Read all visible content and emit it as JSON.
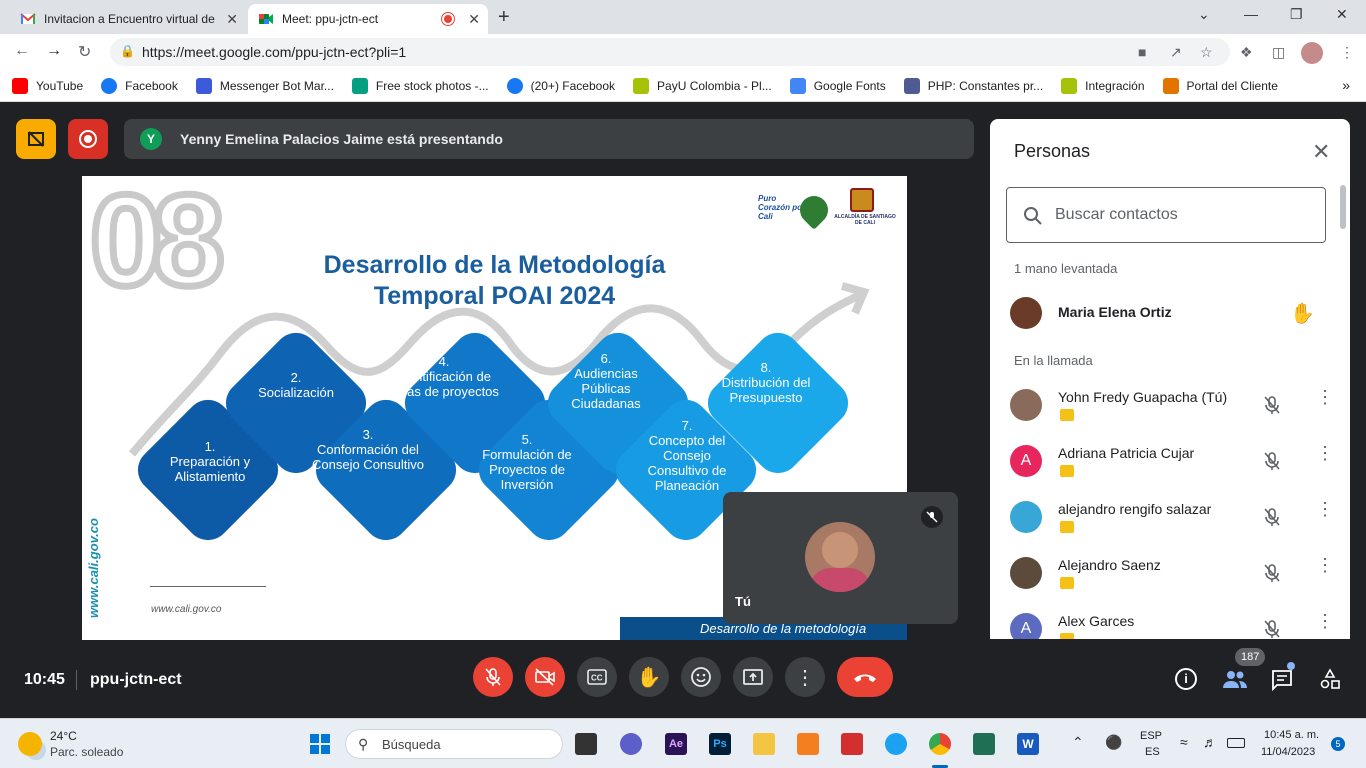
{
  "tabs": [
    {
      "title": "Invitacion a Encuentro virtual de",
      "icon": "gmail-icon",
      "close": "✕"
    },
    {
      "title": "Meet: ppu-jctn-ect",
      "icon": "meet-icon",
      "close": "✕"
    }
  ],
  "new_tab": "+",
  "window_controls": {
    "minimize": "—",
    "maximize": "❐",
    "close": "✕",
    "tab_search": "⌄"
  },
  "url": "https://meet.google.com/ppu-jctn-ect?pli=1",
  "bookmarks": [
    {
      "label": "YouTube",
      "color": "#ff0000"
    },
    {
      "label": "Facebook",
      "color": "#1877f2"
    },
    {
      "label": "Messenger Bot Mar...",
      "color": "#3b5bdb"
    },
    {
      "label": "Free stock photos -...",
      "color": "#05a081"
    },
    {
      "label": "(20+) Facebook",
      "color": "#1877f2"
    },
    {
      "label": "PayU Colombia - Pl...",
      "color": "#a6c307"
    },
    {
      "label": "Google Fonts",
      "color": "#4285f4"
    },
    {
      "label": "PHP: Constantes pr...",
      "color": "#4f5b93"
    },
    {
      "label": "Integración",
      "color": "#a6c307"
    },
    {
      "label": "Portal del Cliente",
      "color": "#e37400"
    }
  ],
  "bookmarks_more": "»",
  "presenter_initial": "Y",
  "presenter_text": "Yenny Emelina Palacios Jaime está presentando",
  "slide": {
    "number": "08",
    "title_line1": "Desarrollo de la Metodología",
    "title_line2": "Temporal POAI 2024",
    "logo_text1": "Puro Corazón por Cali",
    "logo_text2": "ALCALDÍA DE SANTIAGO DE CALI",
    "steps": [
      {
        "num": "1.",
        "text": "Preparación y Alistamiento"
      },
      {
        "num": "2.",
        "text": "Socialización"
      },
      {
        "num": "3.",
        "text": "Conformación del Consejo Consultivo"
      },
      {
        "num": "4.",
        "text": "Identificación de Ideas de proyectos"
      },
      {
        "num": "5.",
        "text": "Formulación de Proyectos de Inversión"
      },
      {
        "num": "6.",
        "text": "Audiencias Públicas Ciudadanas"
      },
      {
        "num": "7.",
        "text": "Concepto del Consejo Consultivo de Planeación"
      },
      {
        "num": "8.",
        "text": "Distribución del Presupuesto"
      }
    ],
    "side_url": "www.cali.gov.co",
    "footer_url": "www.cali.gov.co",
    "footer_bar": "Desarrollo de la metodología"
  },
  "self_tile": {
    "label": "Tú"
  },
  "people_panel": {
    "title": "Personas",
    "search_placeholder": "Buscar contactos",
    "raised_header": "1 mano levantada",
    "raised": [
      {
        "name": "Maria Elena Ortiz",
        "avatar_color": "#6b3b2a"
      }
    ],
    "call_header": "En la llamada",
    "participants": [
      {
        "name": "Yohn Fredy Guapacha (Tú)",
        "avatar_color": "#8a6a5a",
        "initial": ""
      },
      {
        "name": "Adriana Patricia Cujar",
        "avatar_color": "#e8265e",
        "initial": "A"
      },
      {
        "name": "alejandro rengifo salazar",
        "avatar_color": "#38a6d6",
        "initial": ""
      },
      {
        "name": "Alejandro Saenz",
        "avatar_color": "#5c4a3a",
        "initial": ""
      },
      {
        "name": "Alex Garces",
        "avatar_color": "#5c6bc0",
        "initial": "A"
      }
    ]
  },
  "meeting": {
    "time": "10:45",
    "code": "ppu-jctn-ect",
    "participant_count": "187"
  },
  "taskbar": {
    "weather_temp": "24°C",
    "weather_desc": "Parc. soleado",
    "search_label": "Búsqueda",
    "lang1": "ESP",
    "lang2": "ES",
    "clock_time": "10:45 a. m.",
    "clock_date": "11/04/2023",
    "notif": "5"
  },
  "colors": {
    "meet_bg": "#202124",
    "danger": "#ea4335",
    "accent": "#1a73e8",
    "raise_yellow": "#f9ab00"
  }
}
